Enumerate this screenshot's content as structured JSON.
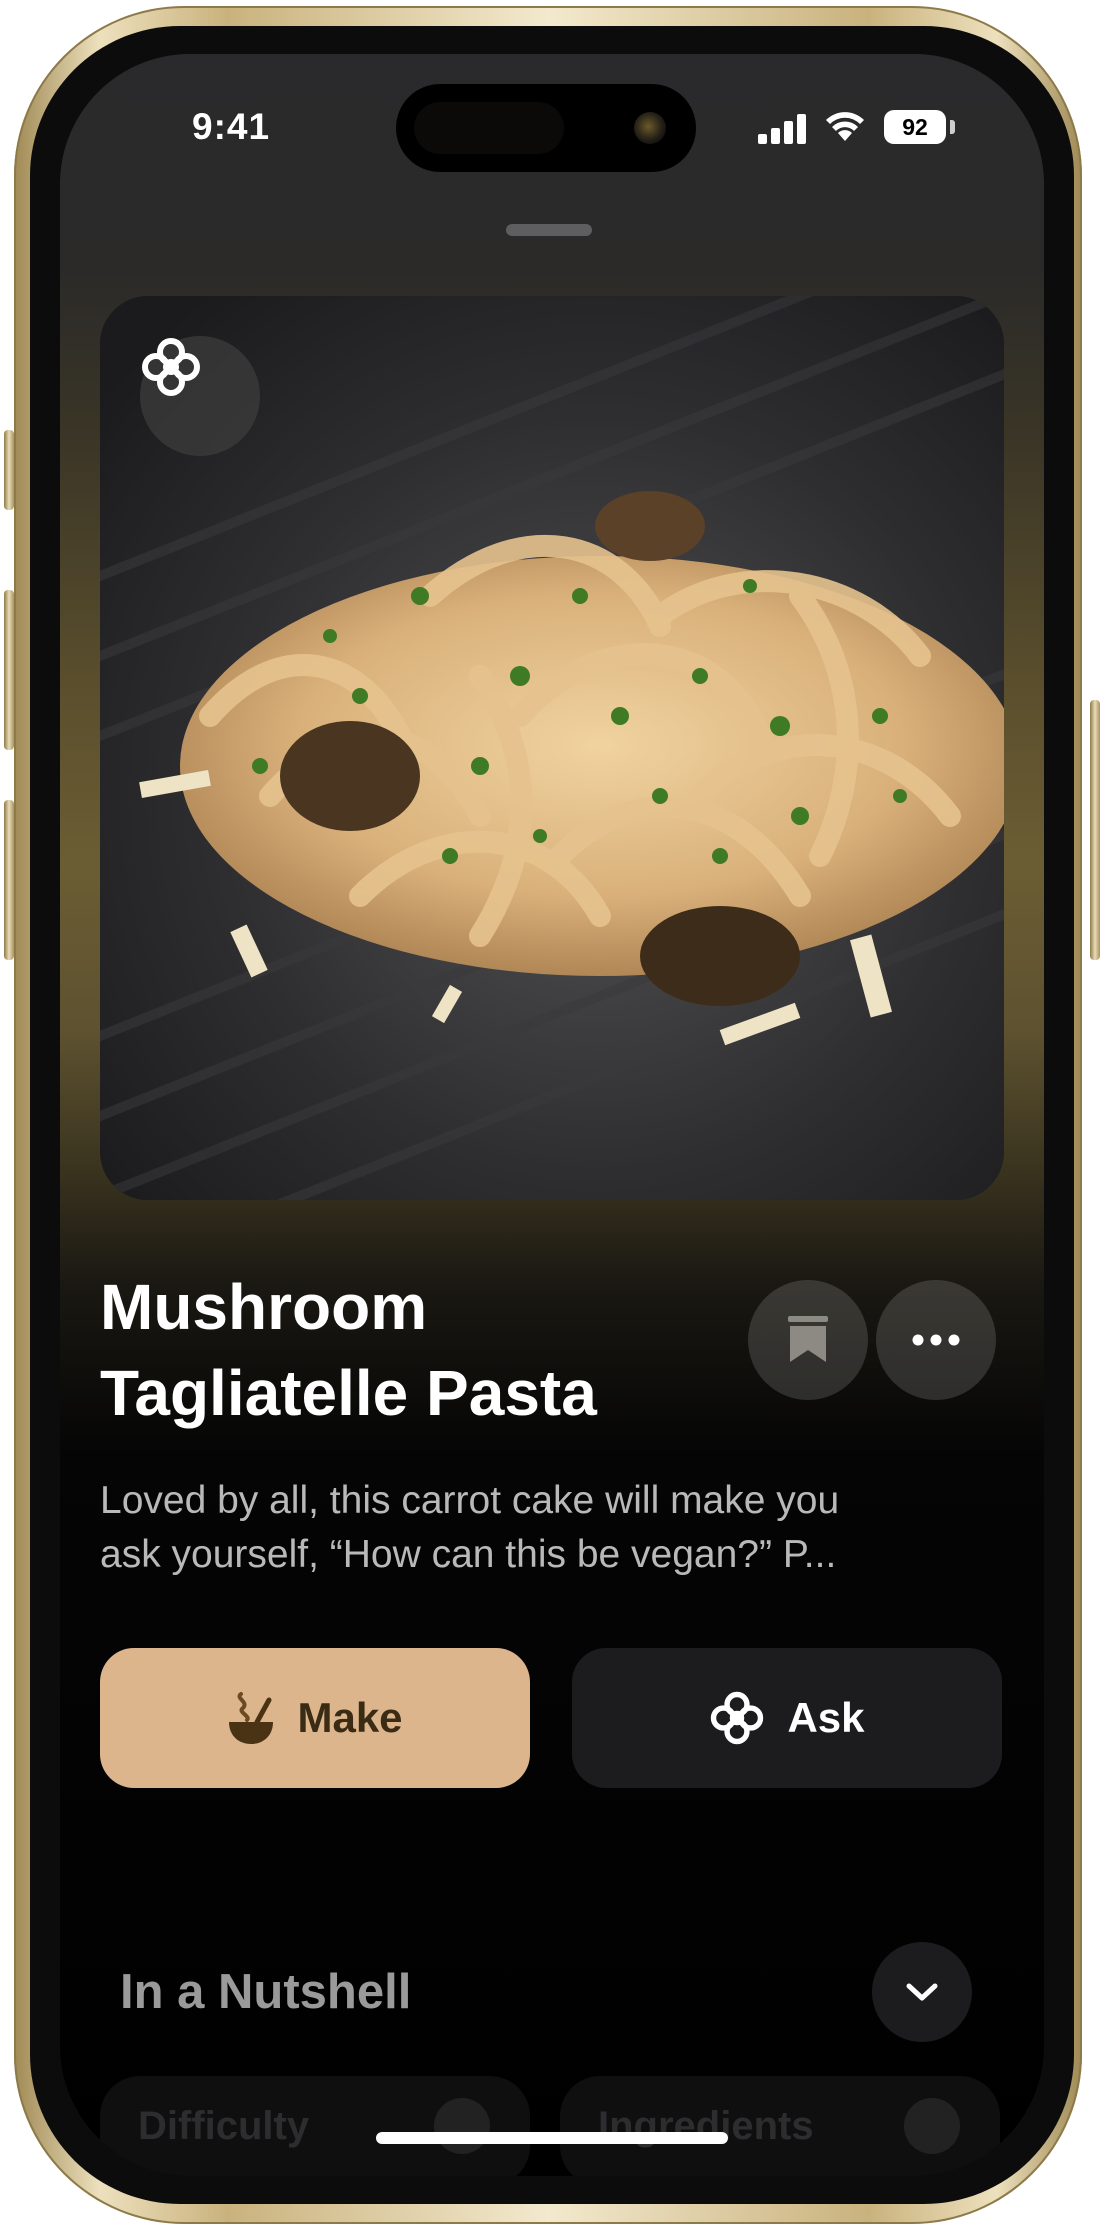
{
  "status_bar": {
    "time": "9:41",
    "battery": "92"
  },
  "recipe": {
    "title_line1": "Mushroom",
    "title_line2": "Tagliatelle Pasta",
    "description_line1": "Loved by all, this carrot cake will make you",
    "description_line2": "ask yourself, “How can this be vegan?” P..."
  },
  "actions": {
    "make_label": "Make",
    "ask_label": "Ask"
  },
  "nutshell": {
    "title": "In a Nutshell",
    "chips": [
      {
        "label": "Difficulty",
        "icon": "ok-hand-icon"
      },
      {
        "label": "Ingredients",
        "icon": "pot-icon"
      }
    ]
  },
  "colors": {
    "make_button": "#ddb58c",
    "ask_button": "#1c1c1e",
    "frame_gold": "#c9b27d"
  },
  "icons": {
    "hero_badge": "clover-icon",
    "bookmark": "bookmark-icon",
    "more": "more-icon",
    "make": "cooking-pot-icon",
    "ask": "clover-icon",
    "expand": "chevron-down-icon"
  }
}
